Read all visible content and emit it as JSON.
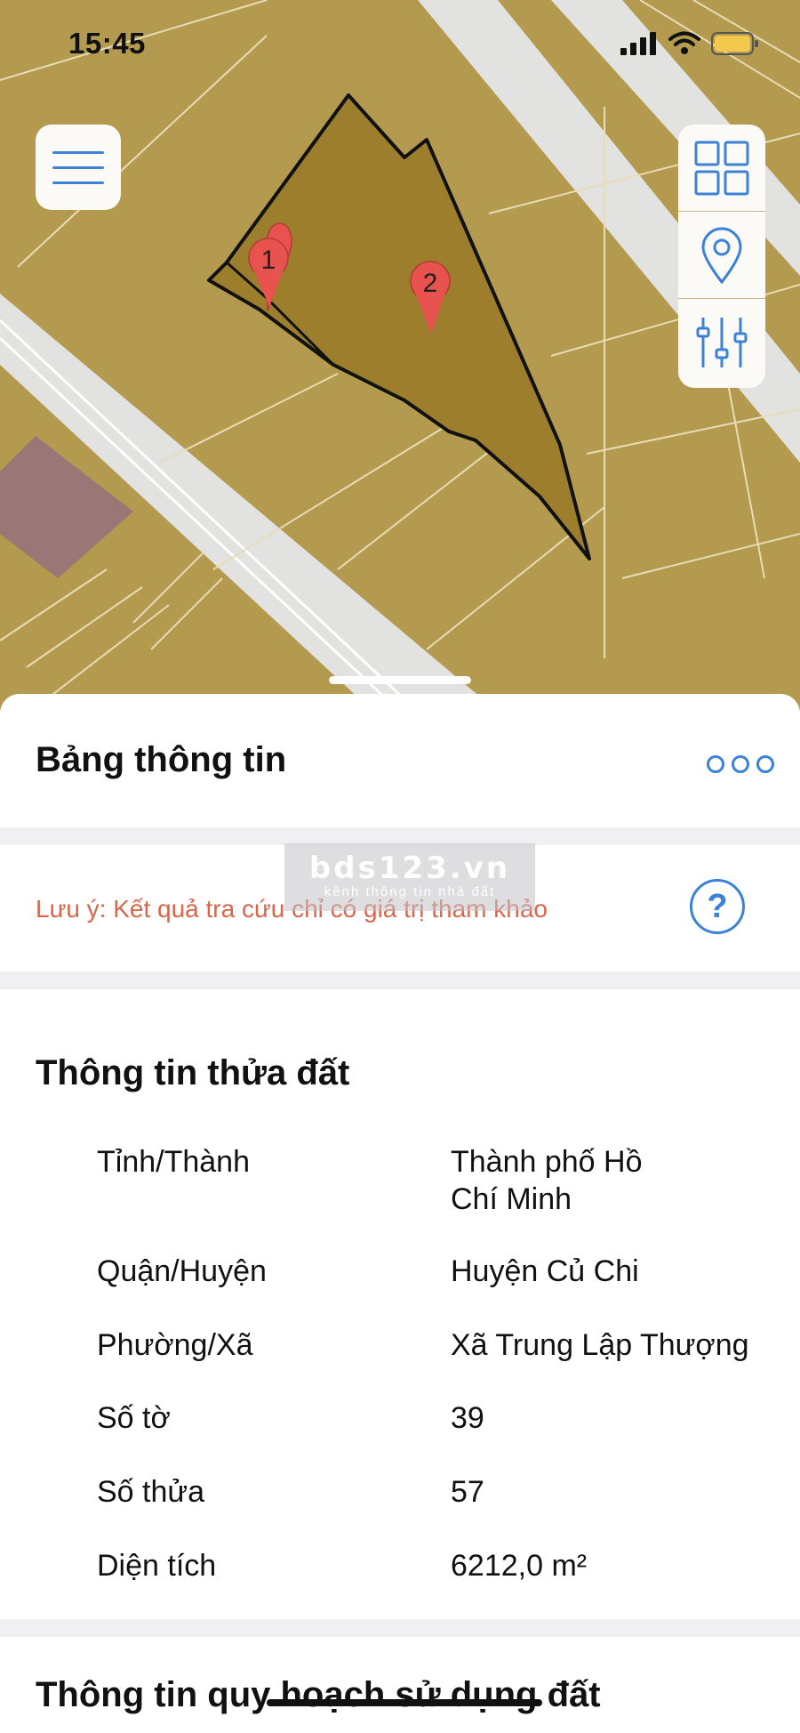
{
  "status_bar": {
    "time": "15:45"
  },
  "map": {
    "parcel_markers": [
      "1",
      "2"
    ],
    "colors": {
      "land": "#b39a4f",
      "parcel": "#9c7e2c",
      "road": "#e2e2e0",
      "zone": "#9b7676",
      "accent": "#3c82d6"
    }
  },
  "toolbar": {
    "menu_icon": "hamburger-icon",
    "tools": [
      "grid-icon",
      "location-pin-icon",
      "sliders-icon"
    ]
  },
  "info_panel": {
    "title": "Bảng thông tin",
    "more_icon": "more-icon",
    "note": "Lưu ý: Kết quả tra cứu chỉ có giá trị tham khảo",
    "help_label": "?",
    "watermark": {
      "main": "bds123.vn",
      "sub": "kênh thông tin nhà đất"
    }
  },
  "parcel_info": {
    "title": "Thông tin thửa đất",
    "rows": [
      {
        "label": "Tỉnh/Thành",
        "value": "Thành phố Hồ Chí Minh"
      },
      {
        "label": "Quận/Huyện",
        "value": "Huyện Củ Chi"
      },
      {
        "label": "Phường/Xã",
        "value": "Xã Trung Lập Thượng"
      },
      {
        "label": "Số tờ",
        "value": "39"
      },
      {
        "label": "Số thửa",
        "value": "57"
      },
      {
        "label": "Diện tích",
        "value": "6212,0 m²"
      }
    ]
  },
  "planning_info": {
    "title": "Thông tin quy hoạch sử dụng đất"
  }
}
